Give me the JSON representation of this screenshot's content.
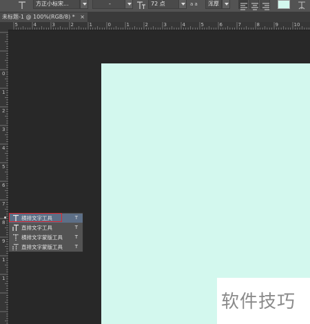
{
  "options_bar": {
    "font_family": "方正小标宋...",
    "font_style": "-",
    "font_size": "72 点",
    "antialias_label": "a a",
    "antialias": "浑厚",
    "text_color": "#d3f8ee"
  },
  "document_tab": {
    "title": "未标题-1 @ 100%(RGB/8) *",
    "close": "×"
  },
  "ruler": {
    "h_labels": [
      "5",
      "4",
      "3",
      "2",
      "1",
      "0",
      "1",
      "2",
      "3",
      "4",
      "5",
      "6",
      "7",
      "8",
      "9",
      "10",
      "11"
    ],
    "v_labels": [
      "0",
      "1",
      "2",
      "3",
      "4",
      "5",
      "6",
      "7",
      "8",
      "9",
      "1",
      "1"
    ]
  },
  "tool_menu": {
    "items": [
      {
        "label": "横排文字工具",
        "shortcut": "T",
        "selected": true,
        "icon": "horizontal-type-icon"
      },
      {
        "label": "直排文字工具",
        "shortcut": "T",
        "selected": false,
        "icon": "vertical-type-icon"
      },
      {
        "label": "横排文字蒙版工具",
        "shortcut": "T",
        "selected": false,
        "icon": "horizontal-type-mask-icon"
      },
      {
        "label": "直排文字蒙版工具",
        "shortcut": "T",
        "selected": false,
        "icon": "vertical-type-mask-icon"
      }
    ]
  },
  "watermark": {
    "text": "软件技巧"
  },
  "colors": {
    "canvas": "#d3f8ee",
    "workspace": "#282828",
    "highlight": "#e0262d",
    "menu_selected": "#5d6f87"
  }
}
